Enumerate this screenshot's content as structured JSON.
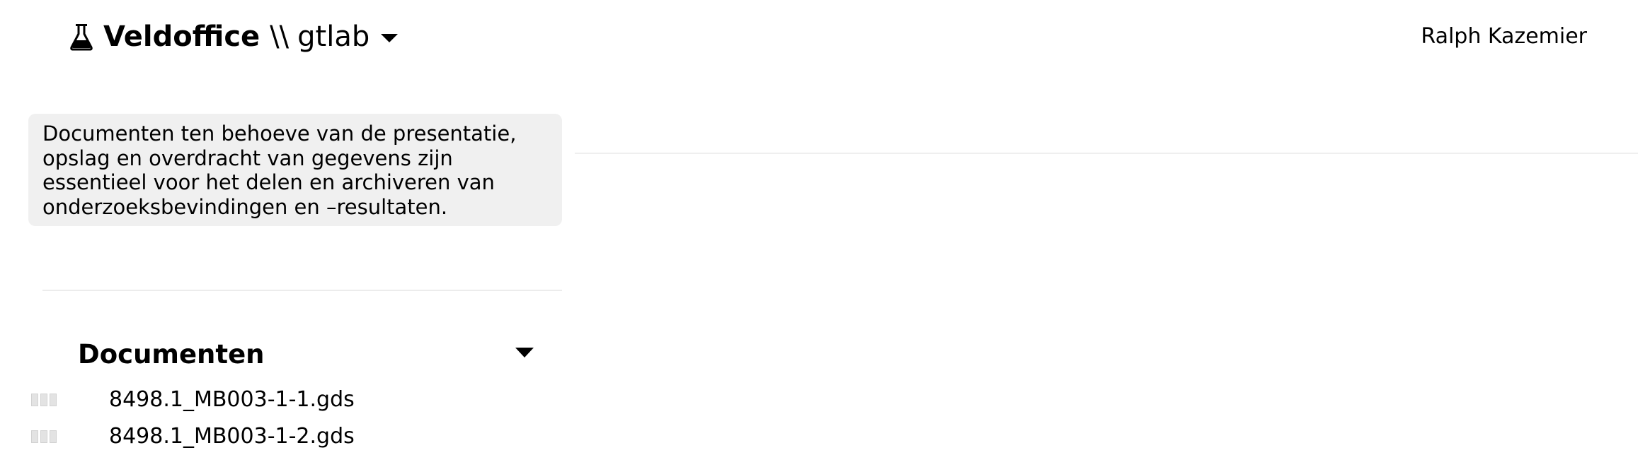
{
  "header": {
    "brand_icon": "flask-icon",
    "brand_name": "Veldoffice",
    "separator": "\\\\",
    "project": "gtlab",
    "user_name": "Ralph Kazemier"
  },
  "sidebar": {
    "description": "Documenten ten behoeve van de presentatie, opslag en overdracht van gegevens zijn essentieel voor het delen en archiveren van onderzoeksbevindingen en –resultaten.",
    "section_title": "Documenten",
    "documents": [
      {
        "name": "8498.1_MB003-1-1.gds"
      },
      {
        "name": "8498.1_MB003-1-2.gds"
      }
    ]
  }
}
